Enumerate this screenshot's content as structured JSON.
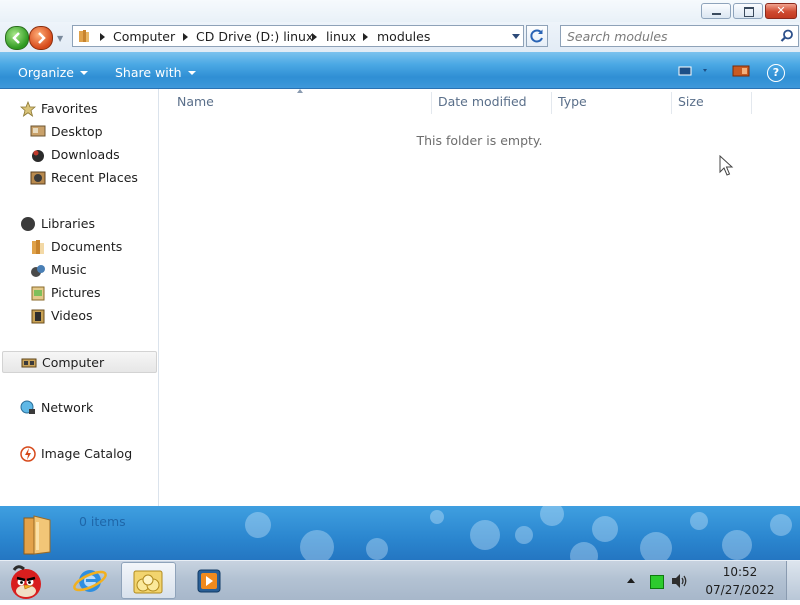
{
  "window": {
    "controls": {
      "minimize": "minimize",
      "maximize": "maximize",
      "close": "close"
    }
  },
  "address_bar": {
    "crumbs": [
      "Computer",
      "CD Drive (D:) linux",
      "linux",
      "modules"
    ]
  },
  "search": {
    "placeholder": "Search modules"
  },
  "command_bar": {
    "organize_label": "Organize",
    "share_label": "Share with"
  },
  "nav_pane": {
    "favorites": "Favorites",
    "favorites_items": [
      "Desktop",
      "Downloads",
      "Recent Places"
    ],
    "libraries": "Libraries",
    "libraries_items": [
      "Documents",
      "Music",
      "Pictures",
      "Videos"
    ],
    "computer": "Computer",
    "network": "Network",
    "image_catalog": "Image Catalog"
  },
  "columns": [
    "Name",
    "Date modified",
    "Type",
    "Size"
  ],
  "empty_message": "This folder is empty.",
  "details_pane": {
    "item_count": "0 items"
  },
  "taskbar": {
    "pinned": [
      "angry-birds-icon",
      "internet-explorer-icon",
      "explorer-folder-icon",
      "media-player-icon"
    ],
    "time": "10:52",
    "date": "07/27/2022"
  },
  "colors": {
    "accent": "#2f8fd4",
    "taskbar": "#b3c2d3",
    "details_pane": "#2b86cf"
  }
}
